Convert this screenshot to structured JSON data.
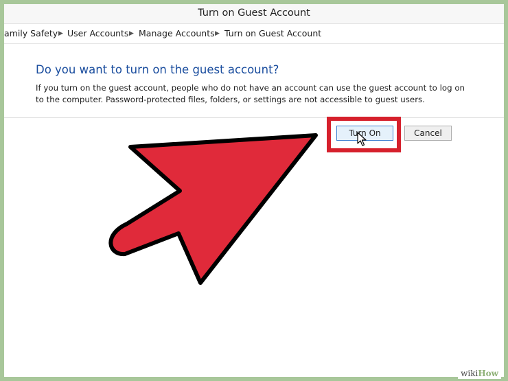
{
  "window": {
    "title": "Turn on Guest Account"
  },
  "breadcrumb": {
    "items": [
      "amily Safety",
      "User Accounts",
      "Manage Accounts",
      "Turn on Guest Account"
    ],
    "separator": "▶"
  },
  "dialog": {
    "heading": "Do you want to turn on the guest account?",
    "description": "If you turn on the guest account, people who do not have an account can use the guest account to log on to the computer. Password-protected files, folders, or settings are not accessible to guest users."
  },
  "buttons": {
    "turn_on": "Turn On",
    "cancel": "Cancel"
  },
  "overlay": {
    "highlight_color": "#d6202c",
    "arrow_color": "#e02a3a",
    "arrow_target": "turn-on-button"
  },
  "watermark": {
    "wiki": "wiki",
    "how": "How"
  },
  "colors": {
    "heading": "#1a4d9e",
    "frame": "#a8c79a"
  }
}
